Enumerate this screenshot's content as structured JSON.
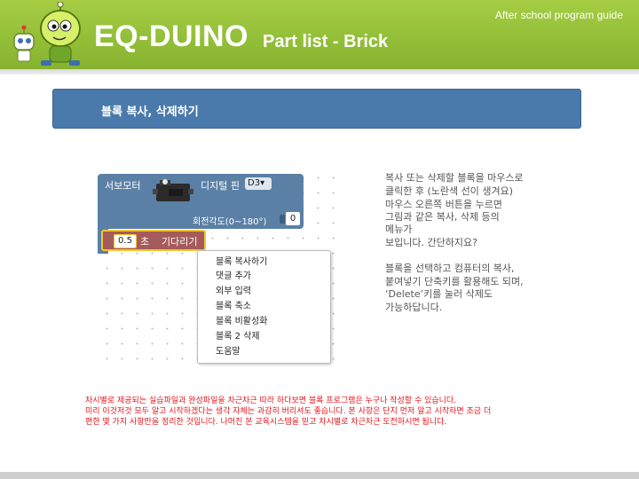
{
  "header": {
    "tagline": "After school program guide",
    "brand": "EQ-DUINO",
    "subtitle": "Part list - Brick"
  },
  "banner": {
    "title": "블록 복사, 삭제하기"
  },
  "blocks": {
    "servo_label": "서보모터",
    "pin_label": "디지털 핀",
    "pin_value": "D3▾",
    "angle_label": "회전각도(0~180°)",
    "angle_value": "0",
    "wait_value": "0.5",
    "wait_unit": "초",
    "wait_label": "기다리기"
  },
  "context_menu": {
    "items": [
      "블록 복사하기",
      "댓글 추가",
      "외부 입력",
      "블록 축소",
      "블록 비활성화",
      "블록 2 삭제",
      "도움말"
    ]
  },
  "description": {
    "lines": [
      "복사 또는 삭제할 블록을  마우스로",
      "클릭한 후 (노란색 선이 생겨요)",
      "마우스 오른쪽 버튼을 누르면",
      "그림과 같은 복사, 삭제 등의",
      "메뉴가",
      "보입니다. 간단하지요?",
      "",
      "블록을 선택하고 컴퓨터의 복사,",
      "붙여넣기 단축키를 활용해도 되며,",
      "‘Delete’키를 눌러 삭제도",
      "가능하답니다."
    ]
  },
  "note": {
    "lines": [
      "차시별로 제공되는 실습파일과 완성파일을 차근차근 따라 하다보면  블록 프로그램은 누구나 작성할 수  있습니다.",
      "미리 이것저것 모두 알고 시작하겠다는 생각 자체는 과감히 버리셔도 좋습니다. 본 사항은 단지 먼저 알고 시작하면 조금 더",
      "편한 몇 가지 사항만을 정리한 것입니다.  나머진 본 교육시스템을 믿고 차시별로 차근차근 도전하시면 됩니다."
    ]
  },
  "colors": {
    "header_green": "#9bc43b",
    "banner_blue": "#4a7aab",
    "servo_block": "#5b80a5",
    "wait_block": "#a55b5b",
    "selection": "#f5c530",
    "note_red": "#e8141b"
  }
}
